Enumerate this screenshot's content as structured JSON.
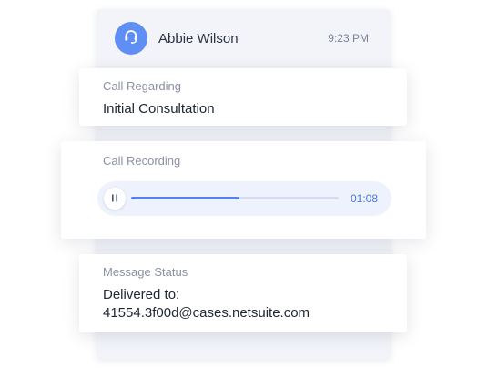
{
  "contact": {
    "name": "Abbie Wilson",
    "time": "9:23 PM",
    "avatar_icon": "headset-icon",
    "avatar_color": "#5f8ef4"
  },
  "call_regarding": {
    "label": "Call Regarding",
    "value": "Initial Consultation"
  },
  "call_recording": {
    "label": "Call Recording",
    "controls_icon": "pause-icon",
    "progress_fraction": 0.52,
    "time": "01:08",
    "accent_color": "#5581e8"
  },
  "message_status": {
    "label": "Message Status",
    "line1": "Delivered to:",
    "line2": "41554.3f00d@cases.netsuite.com"
  }
}
